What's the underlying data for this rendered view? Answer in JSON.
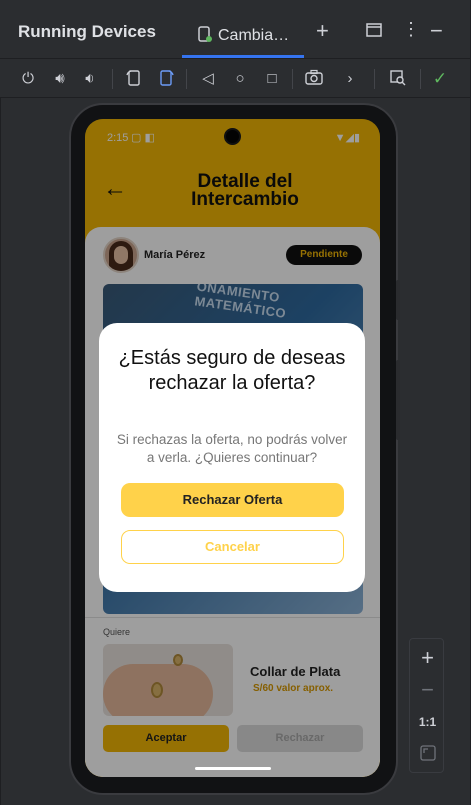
{
  "tool_window": {
    "title": "Running Devices",
    "tab_label": "Cambia…"
  },
  "icons": {
    "add": "plus-icon",
    "restore": "window-icon",
    "more": "more-vertical-icon",
    "minimize": "minus-icon"
  },
  "phone_status": {
    "time": "2:15"
  },
  "app": {
    "title_line1": "Detalle del",
    "title_line2": "Intercambio",
    "user_name": "María Pérez",
    "status_badge": "Pendiente",
    "photo_text": "ONAMIENTO MATEMÁTICO",
    "wants_label": "Quiere",
    "item_name": "Collar de Plata",
    "item_price": "S/60 valor aprox.",
    "accept_label": "Aceptar",
    "reject_label": "Rechazar"
  },
  "dialog": {
    "title": "¿Estás seguro de deseas rechazar la oferta?",
    "message": "Si rechazas la oferta, no podrás volver a verla. ¿Quieres continuar?",
    "confirm_label": "Rechazar Oferta",
    "cancel_label": "Cancelar"
  },
  "zoom": {
    "in": "+",
    "out": "−",
    "actual": "1:1"
  },
  "colors": {
    "accent": "#f2b705",
    "dialog_button": "#ffd24a",
    "ide_bg": "#2b2d30",
    "ide_tab_underline": "#3574f0"
  }
}
